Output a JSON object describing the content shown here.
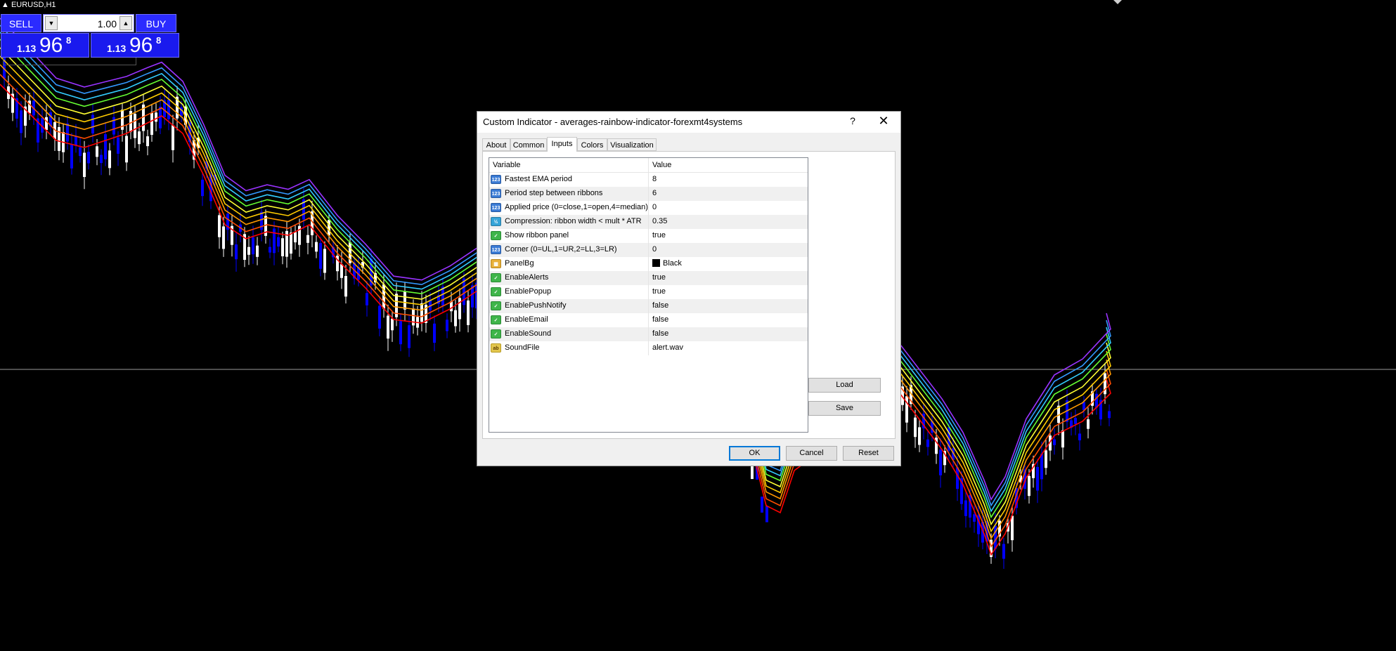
{
  "chart": {
    "symbol": "EURUSD,H1",
    "line_colors": [
      "#ff0000",
      "#ff4d00",
      "#ff9900",
      "#ffcc00",
      "#ffff33",
      "#66ff33",
      "#33ccff",
      "#3399ff",
      "#9933ff"
    ],
    "candle_bull": "#ffffff",
    "candle_bear": "#0000ff"
  },
  "trade": {
    "sell_label": "SELL",
    "buy_label": "BUY",
    "lot_value": "1.00",
    "sell_price_small": "1.13",
    "sell_price_big": "96",
    "sell_price_sup": "8",
    "buy_price_small": "1.13",
    "buy_price_big": "96",
    "buy_price_sup": "8"
  },
  "dialog": {
    "title": "Custom Indicator - averages-rainbow-indicator-forexmt4systems",
    "help": "?",
    "close": "✕",
    "tabs": [
      "About",
      "Common",
      "Inputs",
      "Colors",
      "Visualization"
    ],
    "active_tab": "Inputs",
    "columns": {
      "variable": "Variable",
      "value": "Value"
    },
    "rows": [
      {
        "type": "int",
        "variable": "Fastest EMA period",
        "value": "8"
      },
      {
        "type": "int",
        "variable": "Period step between ribbons",
        "value": "6"
      },
      {
        "type": "int",
        "variable": "Applied price (0=close,1=open,4=median)",
        "value": "0"
      },
      {
        "type": "double",
        "variable": "Compression: ribbon width < mult * ATR",
        "value": "0.35"
      },
      {
        "type": "bool",
        "variable": "Show ribbon panel",
        "value": "true"
      },
      {
        "type": "int",
        "variable": "Corner (0=UL,1=UR,2=LL,3=LR)",
        "value": "0"
      },
      {
        "type": "color",
        "variable": "PanelBg",
        "value": "Black"
      },
      {
        "type": "bool",
        "variable": "EnableAlerts",
        "value": "true"
      },
      {
        "type": "bool",
        "variable": "EnablePopup",
        "value": "true"
      },
      {
        "type": "bool",
        "variable": "EnablePushNotify",
        "value": "false"
      },
      {
        "type": "bool",
        "variable": "EnableEmail",
        "value": "false"
      },
      {
        "type": "bool",
        "variable": "EnableSound",
        "value": "false"
      },
      {
        "type": "string",
        "variable": "SoundFile",
        "value": "alert.wav"
      }
    ],
    "load_label": "Load",
    "save_label": "Save",
    "ok_label": "OK",
    "cancel_label": "Cancel",
    "reset_label": "Reset"
  }
}
